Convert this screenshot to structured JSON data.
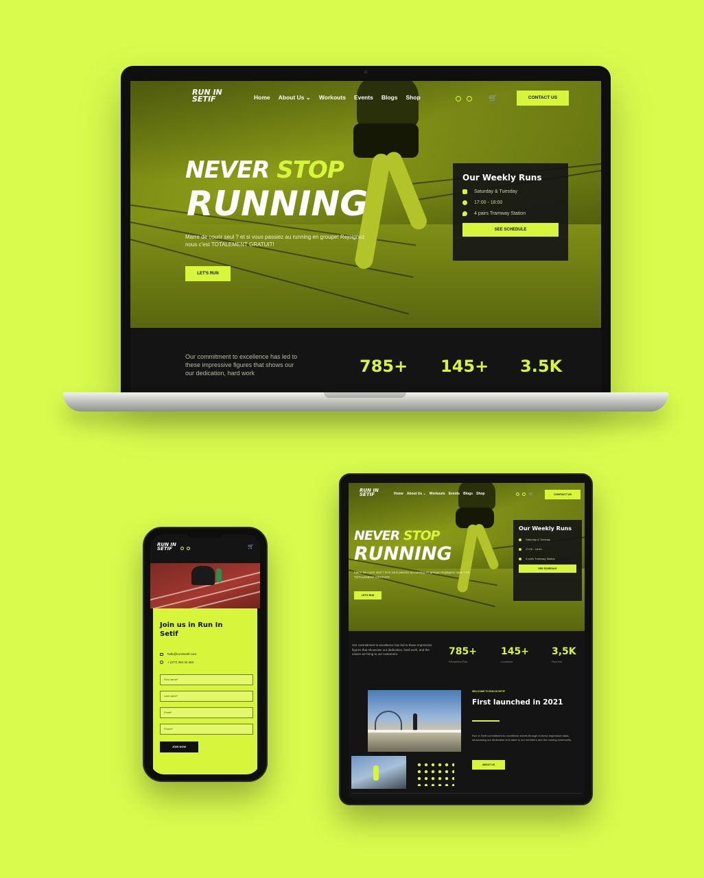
{
  "brand": {
    "logo_line1": "RUN IN",
    "logo_line2": "SETIF"
  },
  "nav": {
    "links": [
      "Home",
      "About Us ⌄",
      "Workouts",
      "Events",
      "Blogs",
      "Shop"
    ],
    "contact_label": "CONTACT US",
    "cart_count": "0"
  },
  "hero": {
    "title_never": "NEVER",
    "title_stop": "STOP",
    "title_running": "RUNNING",
    "subtitle": "Marre de courir seul ? et si vous passiez au running en groupe! Rejoignez nous c'est TOTALEMENT GRATUIT!",
    "cta_label": "LET'S RUN"
  },
  "weekly_runs": {
    "title": "Our Weekly Runs",
    "days": "Saturday & Tuesday",
    "time": "17:00 - 18:00",
    "place": "4 pairs Tramway Station",
    "button_label": "SEE SCHEDULE"
  },
  "stats": {
    "intro": "Our commitment to excellence has led to these impressive figures that showcase our dedication, hard work, and the values we bring to our customers.",
    "intro_laptop": "Our commitment to excellence has led to these impressive figures that shows our our dedication, hard work",
    "items": [
      {
        "value": "785+",
        "label": "Kilometers Run"
      },
      {
        "value": "145+",
        "label": "Locations"
      },
      {
        "value": "3.5K",
        "label": "Runners"
      }
    ],
    "tablet_third_value": "3,5K"
  },
  "about": {
    "eyebrow": "WELCOME TO RUN IN SETIF",
    "title": "First launched in 2021",
    "text": "Run In Setif commitment to excellence shines through in these impressive stats, showcasing our dedication and value to our members and the running community.",
    "button_label": "ABOUT US"
  },
  "join": {
    "title": "Join us in Run In Setif",
    "email": "hello@runinsetif.com",
    "phone": "+ (077) 384 34 453",
    "placeholders": [
      "First name*",
      "Last name*",
      "Email*",
      "Phone*"
    ],
    "button_label": "JOIN NOW"
  },
  "colors": {
    "background": "#d9fb4e",
    "accent": "#d7f53a",
    "dark": "#141414"
  }
}
